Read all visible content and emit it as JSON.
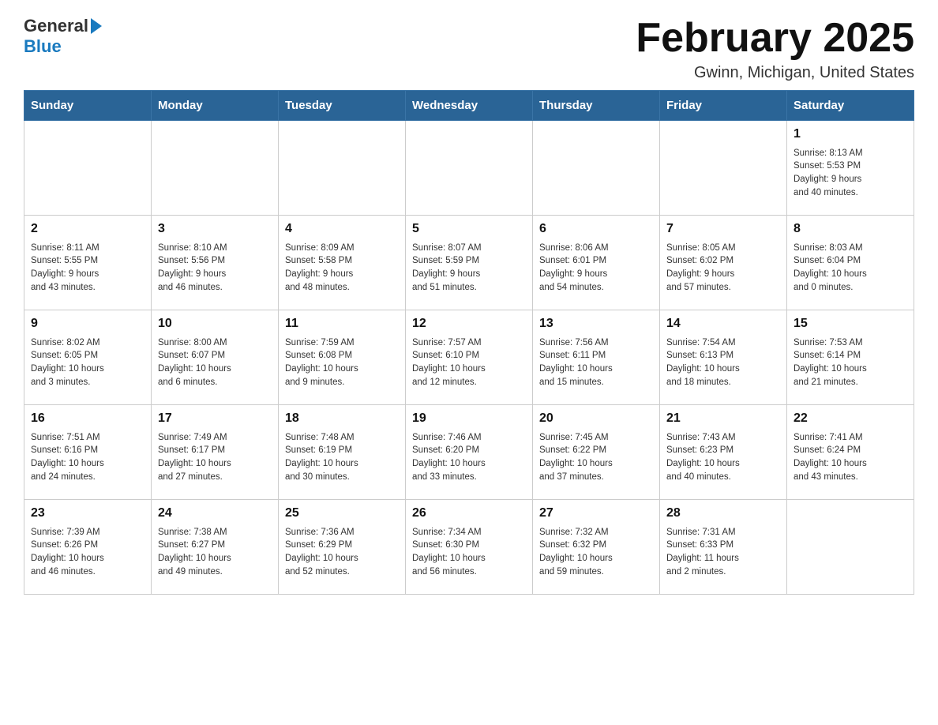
{
  "header": {
    "logo_general": "General",
    "logo_blue": "Blue",
    "title": "February 2025",
    "subtitle": "Gwinn, Michigan, United States"
  },
  "days_of_week": [
    "Sunday",
    "Monday",
    "Tuesday",
    "Wednesday",
    "Thursday",
    "Friday",
    "Saturday"
  ],
  "weeks": [
    [
      {
        "day": "",
        "info": ""
      },
      {
        "day": "",
        "info": ""
      },
      {
        "day": "",
        "info": ""
      },
      {
        "day": "",
        "info": ""
      },
      {
        "day": "",
        "info": ""
      },
      {
        "day": "",
        "info": ""
      },
      {
        "day": "1",
        "info": "Sunrise: 8:13 AM\nSunset: 5:53 PM\nDaylight: 9 hours\nand 40 minutes."
      }
    ],
    [
      {
        "day": "2",
        "info": "Sunrise: 8:11 AM\nSunset: 5:55 PM\nDaylight: 9 hours\nand 43 minutes."
      },
      {
        "day": "3",
        "info": "Sunrise: 8:10 AM\nSunset: 5:56 PM\nDaylight: 9 hours\nand 46 minutes."
      },
      {
        "day": "4",
        "info": "Sunrise: 8:09 AM\nSunset: 5:58 PM\nDaylight: 9 hours\nand 48 minutes."
      },
      {
        "day": "5",
        "info": "Sunrise: 8:07 AM\nSunset: 5:59 PM\nDaylight: 9 hours\nand 51 minutes."
      },
      {
        "day": "6",
        "info": "Sunrise: 8:06 AM\nSunset: 6:01 PM\nDaylight: 9 hours\nand 54 minutes."
      },
      {
        "day": "7",
        "info": "Sunrise: 8:05 AM\nSunset: 6:02 PM\nDaylight: 9 hours\nand 57 minutes."
      },
      {
        "day": "8",
        "info": "Sunrise: 8:03 AM\nSunset: 6:04 PM\nDaylight: 10 hours\nand 0 minutes."
      }
    ],
    [
      {
        "day": "9",
        "info": "Sunrise: 8:02 AM\nSunset: 6:05 PM\nDaylight: 10 hours\nand 3 minutes."
      },
      {
        "day": "10",
        "info": "Sunrise: 8:00 AM\nSunset: 6:07 PM\nDaylight: 10 hours\nand 6 minutes."
      },
      {
        "day": "11",
        "info": "Sunrise: 7:59 AM\nSunset: 6:08 PM\nDaylight: 10 hours\nand 9 minutes."
      },
      {
        "day": "12",
        "info": "Sunrise: 7:57 AM\nSunset: 6:10 PM\nDaylight: 10 hours\nand 12 minutes."
      },
      {
        "day": "13",
        "info": "Sunrise: 7:56 AM\nSunset: 6:11 PM\nDaylight: 10 hours\nand 15 minutes."
      },
      {
        "day": "14",
        "info": "Sunrise: 7:54 AM\nSunset: 6:13 PM\nDaylight: 10 hours\nand 18 minutes."
      },
      {
        "day": "15",
        "info": "Sunrise: 7:53 AM\nSunset: 6:14 PM\nDaylight: 10 hours\nand 21 minutes."
      }
    ],
    [
      {
        "day": "16",
        "info": "Sunrise: 7:51 AM\nSunset: 6:16 PM\nDaylight: 10 hours\nand 24 minutes."
      },
      {
        "day": "17",
        "info": "Sunrise: 7:49 AM\nSunset: 6:17 PM\nDaylight: 10 hours\nand 27 minutes."
      },
      {
        "day": "18",
        "info": "Sunrise: 7:48 AM\nSunset: 6:19 PM\nDaylight: 10 hours\nand 30 minutes."
      },
      {
        "day": "19",
        "info": "Sunrise: 7:46 AM\nSunset: 6:20 PM\nDaylight: 10 hours\nand 33 minutes."
      },
      {
        "day": "20",
        "info": "Sunrise: 7:45 AM\nSunset: 6:22 PM\nDaylight: 10 hours\nand 37 minutes."
      },
      {
        "day": "21",
        "info": "Sunrise: 7:43 AM\nSunset: 6:23 PM\nDaylight: 10 hours\nand 40 minutes."
      },
      {
        "day": "22",
        "info": "Sunrise: 7:41 AM\nSunset: 6:24 PM\nDaylight: 10 hours\nand 43 minutes."
      }
    ],
    [
      {
        "day": "23",
        "info": "Sunrise: 7:39 AM\nSunset: 6:26 PM\nDaylight: 10 hours\nand 46 minutes."
      },
      {
        "day": "24",
        "info": "Sunrise: 7:38 AM\nSunset: 6:27 PM\nDaylight: 10 hours\nand 49 minutes."
      },
      {
        "day": "25",
        "info": "Sunrise: 7:36 AM\nSunset: 6:29 PM\nDaylight: 10 hours\nand 52 minutes."
      },
      {
        "day": "26",
        "info": "Sunrise: 7:34 AM\nSunset: 6:30 PM\nDaylight: 10 hours\nand 56 minutes."
      },
      {
        "day": "27",
        "info": "Sunrise: 7:32 AM\nSunset: 6:32 PM\nDaylight: 10 hours\nand 59 minutes."
      },
      {
        "day": "28",
        "info": "Sunrise: 7:31 AM\nSunset: 6:33 PM\nDaylight: 11 hours\nand 2 minutes."
      },
      {
        "day": "",
        "info": ""
      }
    ]
  ]
}
